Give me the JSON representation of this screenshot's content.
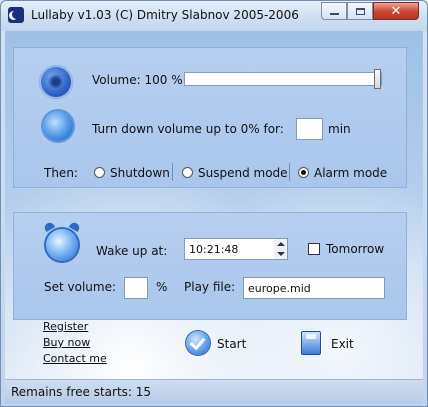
{
  "window": {
    "title": "Lullaby v1.03 (C) Dmitry Slabnov 2005-2006",
    "close_glyph": "✕"
  },
  "volume": {
    "label": "Volume: 100 %",
    "value_percent": 100
  },
  "turn_down": {
    "label": "Turn down volume up to 0%  for:",
    "minutes_value": "",
    "unit": "min"
  },
  "then": {
    "label": "Then:",
    "options": [
      {
        "label": "Shutdown",
        "checked": false
      },
      {
        "label": "Suspend mode",
        "checked": false
      },
      {
        "label": "Alarm mode",
        "checked": true
      }
    ]
  },
  "alarm": {
    "wake_label": "Wake up at:",
    "time_value": "10:21:48",
    "tomorrow_label": "Tomorrow",
    "tomorrow_checked": false,
    "set_volume_label": "Set volume:",
    "set_volume_value": "",
    "percent_sign": "%",
    "play_file_label": "Play file:",
    "play_file_value": "europe.mid"
  },
  "links": {
    "register": "Register",
    "buy_now": "Buy now",
    "contact_me": "Contact me"
  },
  "actions": {
    "start": "Start",
    "exit": "Exit"
  },
  "status": {
    "text": "Remains free starts: 15"
  }
}
